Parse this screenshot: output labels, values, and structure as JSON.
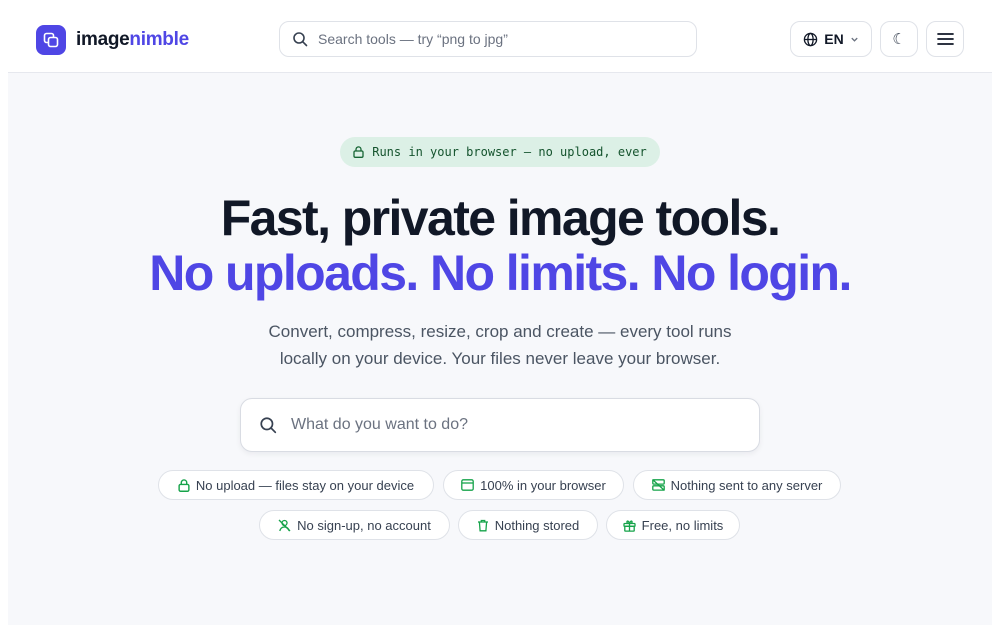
{
  "header": {
    "logo": {
      "part1": "image",
      "part2": "nimble"
    },
    "search": {
      "placeholder": "Search tools — try “png to jpg”"
    },
    "language": {
      "label": "EN"
    },
    "theme_toggle": {
      "icon": "moon-icon"
    },
    "menu": {
      "icon": "hamburger-menu-icon"
    }
  },
  "hero": {
    "badge": "Runs in your browser — no upload, ever",
    "title_line1": "Fast, private image tools.",
    "title_line2": "No uploads. No limits. No login.",
    "subtitle_line1": "Convert, compress, resize, crop and create — every tool runs",
    "subtitle_line2": "locally on your device. Your files never leave your browser.",
    "search": {
      "placeholder": "What do you want to do?"
    }
  },
  "features": [
    {
      "label": "No upload — files stay on your device",
      "icon": "lock-icon"
    },
    {
      "label": "100% in your browser",
      "icon": "browser-window-icon"
    },
    {
      "label": "Nothing sent to any server",
      "icon": "no-server-icon"
    },
    {
      "label": "No sign-up, no account",
      "icon": "no-user-icon"
    },
    {
      "label": "Nothing stored",
      "icon": "trash-icon"
    },
    {
      "label": "Free, no limits",
      "icon": "gift-icon"
    }
  ],
  "colors": {
    "brand": "#4f46e5",
    "accent_green": "#16a34a",
    "badge_bg": "#dcf0e6",
    "page_bg": "#f7f8fb"
  }
}
